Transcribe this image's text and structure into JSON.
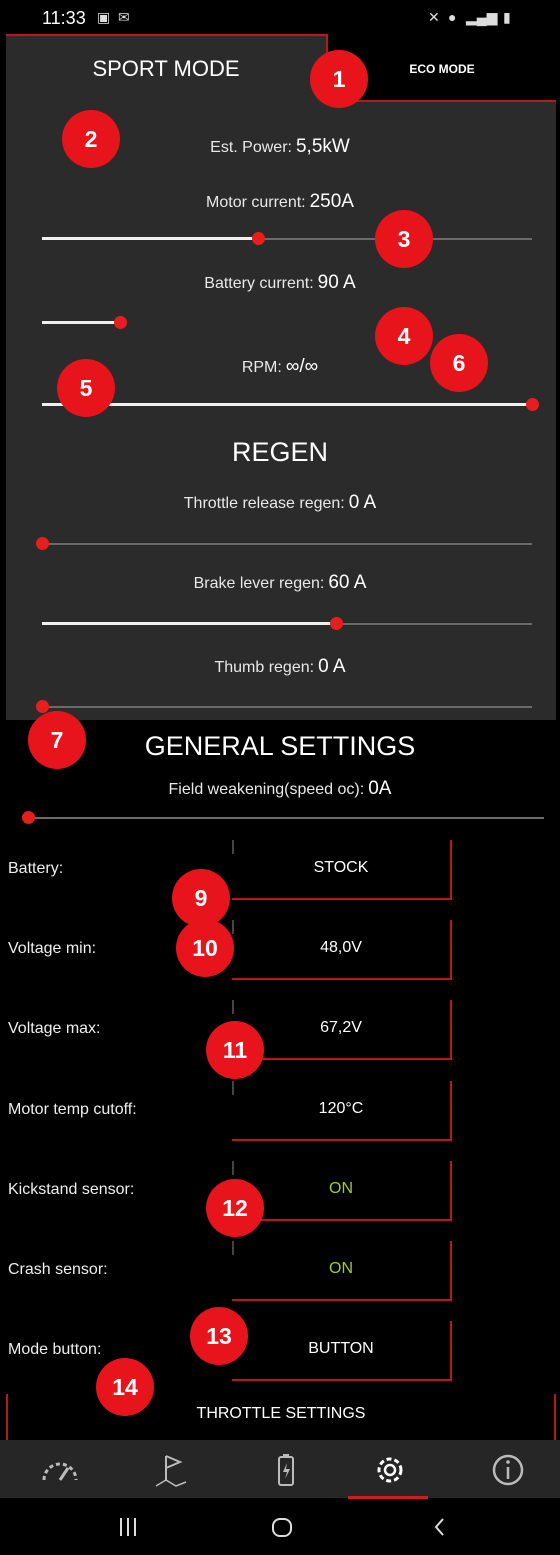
{
  "status_bar": {
    "time": "11:33"
  },
  "tabs": {
    "sport": "SPORT MODE",
    "eco": "ECO MODE"
  },
  "sport": {
    "est_power_label": "Est. Power:",
    "est_power_value": "5,5kW",
    "motor_current_label": "Motor current:",
    "motor_current_value": "250A",
    "motor_current_fraction": 0.44,
    "battery_current_label": "Battery current:",
    "battery_current_value": "90 A",
    "battery_current_fraction": 0.16,
    "rpm_label": "RPM:",
    "rpm_value": "∞/∞",
    "rpm_fraction": 1.0
  },
  "regen": {
    "title": "REGEN",
    "throttle_release_label": "Throttle release regen:",
    "throttle_release_value": "0 A",
    "throttle_release_fraction": 0.0,
    "brake_lever_label": "Brake lever regen:",
    "brake_lever_value": "60 A",
    "brake_lever_fraction": 0.6,
    "thumb_label": "Thumb regen:",
    "thumb_value": "0 A",
    "thumb_fraction": 0.0
  },
  "general": {
    "title": "GENERAL SETTINGS",
    "field_weakening_label": "Field weakening(speed oc):",
    "field_weakening_value": "0A",
    "field_weakening_fraction": 0.0,
    "battery_label": "Battery:",
    "battery_value": "STOCK",
    "voltage_min_label": "Voltage min:",
    "voltage_min_value": "48,0V",
    "voltage_max_label": "Voltage max:",
    "voltage_max_value": "67,2V",
    "motor_temp_label": "Motor temp cutoff:",
    "motor_temp_value": "120°C",
    "kickstand_label": "Kickstand sensor:",
    "kickstand_value": "ON",
    "crash_label": "Crash sensor:",
    "crash_value": "ON",
    "mode_button_label": "Mode button:",
    "mode_button_value": "BUTTON",
    "throttle_settings_label": "THROTTLE SETTINGS"
  },
  "badges": [
    "1",
    "2",
    "3",
    "4",
    "5",
    "6",
    "7",
    "9",
    "10",
    "11",
    "12",
    "13",
    "14"
  ],
  "colors": {
    "accent": "#e61e1e",
    "panel": "#2b2b2b",
    "on_green": "#9ccc3a"
  },
  "nav_icons": [
    "speedometer-icon",
    "flag-route-icon",
    "battery-icon",
    "gear-icon",
    "info-icon"
  ]
}
